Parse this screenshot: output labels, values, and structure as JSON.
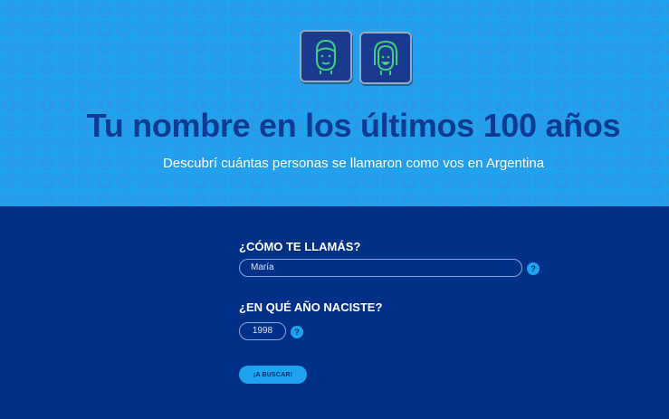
{
  "hero": {
    "title": "Tu nombre en los últimos 100 años",
    "subtitle": "Descubrí cuántas personas se llamaron como vos en Argentina"
  },
  "form": {
    "name_label": "¿CÓMO TE LLAMÁS?",
    "name_value": "María",
    "year_label": "¿EN QUÉ AÑO NACISTE?",
    "year_value": "1998",
    "help_glyph": "?",
    "search_label": "¡A BUSCAR!"
  },
  "colors": {
    "hero_bg": "#1fa3ef",
    "page_bg": "#003087",
    "title": "#0d3a93",
    "accent": "#1fa3ef"
  },
  "icons": [
    "male-face-icon",
    "female-face-icon",
    "help-icon"
  ]
}
